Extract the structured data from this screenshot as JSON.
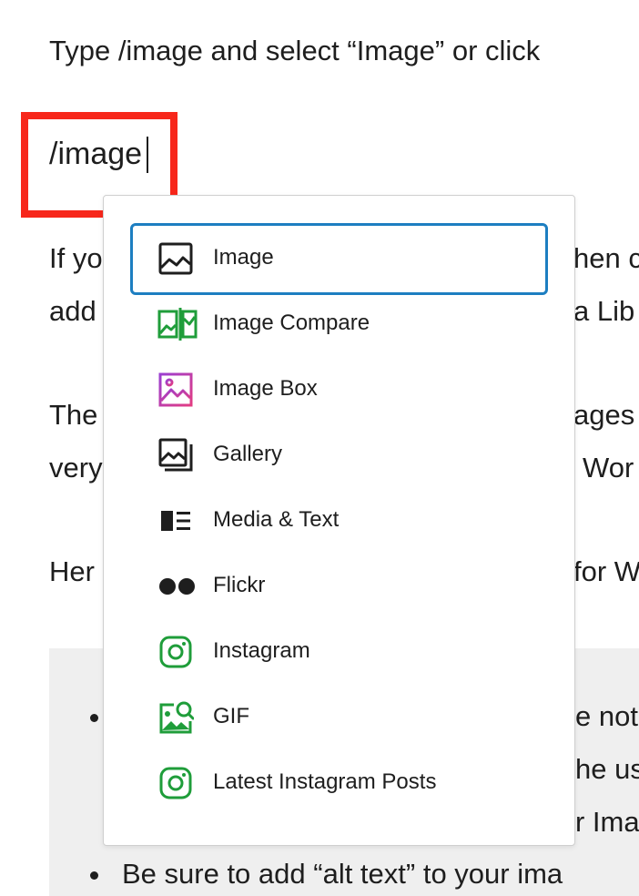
{
  "content": {
    "intro_text": "Type /image and select “Image” or click",
    "command_text": "/image",
    "para1_line1_start": "If yo",
    "para1_line1_end": "hen c",
    "para1_line2_start": "add",
    "para1_line2_end": "a Lib",
    "para2_line1_start": "The",
    "para2_line1_end": "ages",
    "para2_line2_start": "very",
    "para2_line2_end": "Wor",
    "para3_start": "Her",
    "para3_end": "for W",
    "bullet1_end": "e not",
    "bullet1_line2_end": "he us",
    "bullet1_line3_end": "r Ima",
    "bullet2_text": "Be sure to add “alt text” to your ima"
  },
  "popover": {
    "items": [
      {
        "label": "Image",
        "icon": "image-icon",
        "color": "#1e1e1e",
        "selected": true
      },
      {
        "label": "Image Compare",
        "icon": "image-compare-icon",
        "color": "#1f9d3a"
      },
      {
        "label": "Image Box",
        "icon": "image-box-icon",
        "color": "#9b3fd1"
      },
      {
        "label": "Gallery",
        "icon": "gallery-icon",
        "color": "#1e1e1e"
      },
      {
        "label": "Media & Text",
        "icon": "media-text-icon",
        "color": "#1e1e1e"
      },
      {
        "label": "Flickr",
        "icon": "flickr-icon",
        "color": "#1e1e1e"
      },
      {
        "label": "Instagram",
        "icon": "instagram-icon",
        "color": "#1f9d3a"
      },
      {
        "label": "GIF",
        "icon": "gif-icon",
        "color": "#1f9d3a"
      },
      {
        "label": "Latest Instagram Posts",
        "icon": "instagram-icon",
        "color": "#1f9d3a"
      }
    ]
  },
  "colors": {
    "highlight": "#f7271b",
    "selection": "#1d7ec1",
    "quote_bg": "#efefef"
  }
}
